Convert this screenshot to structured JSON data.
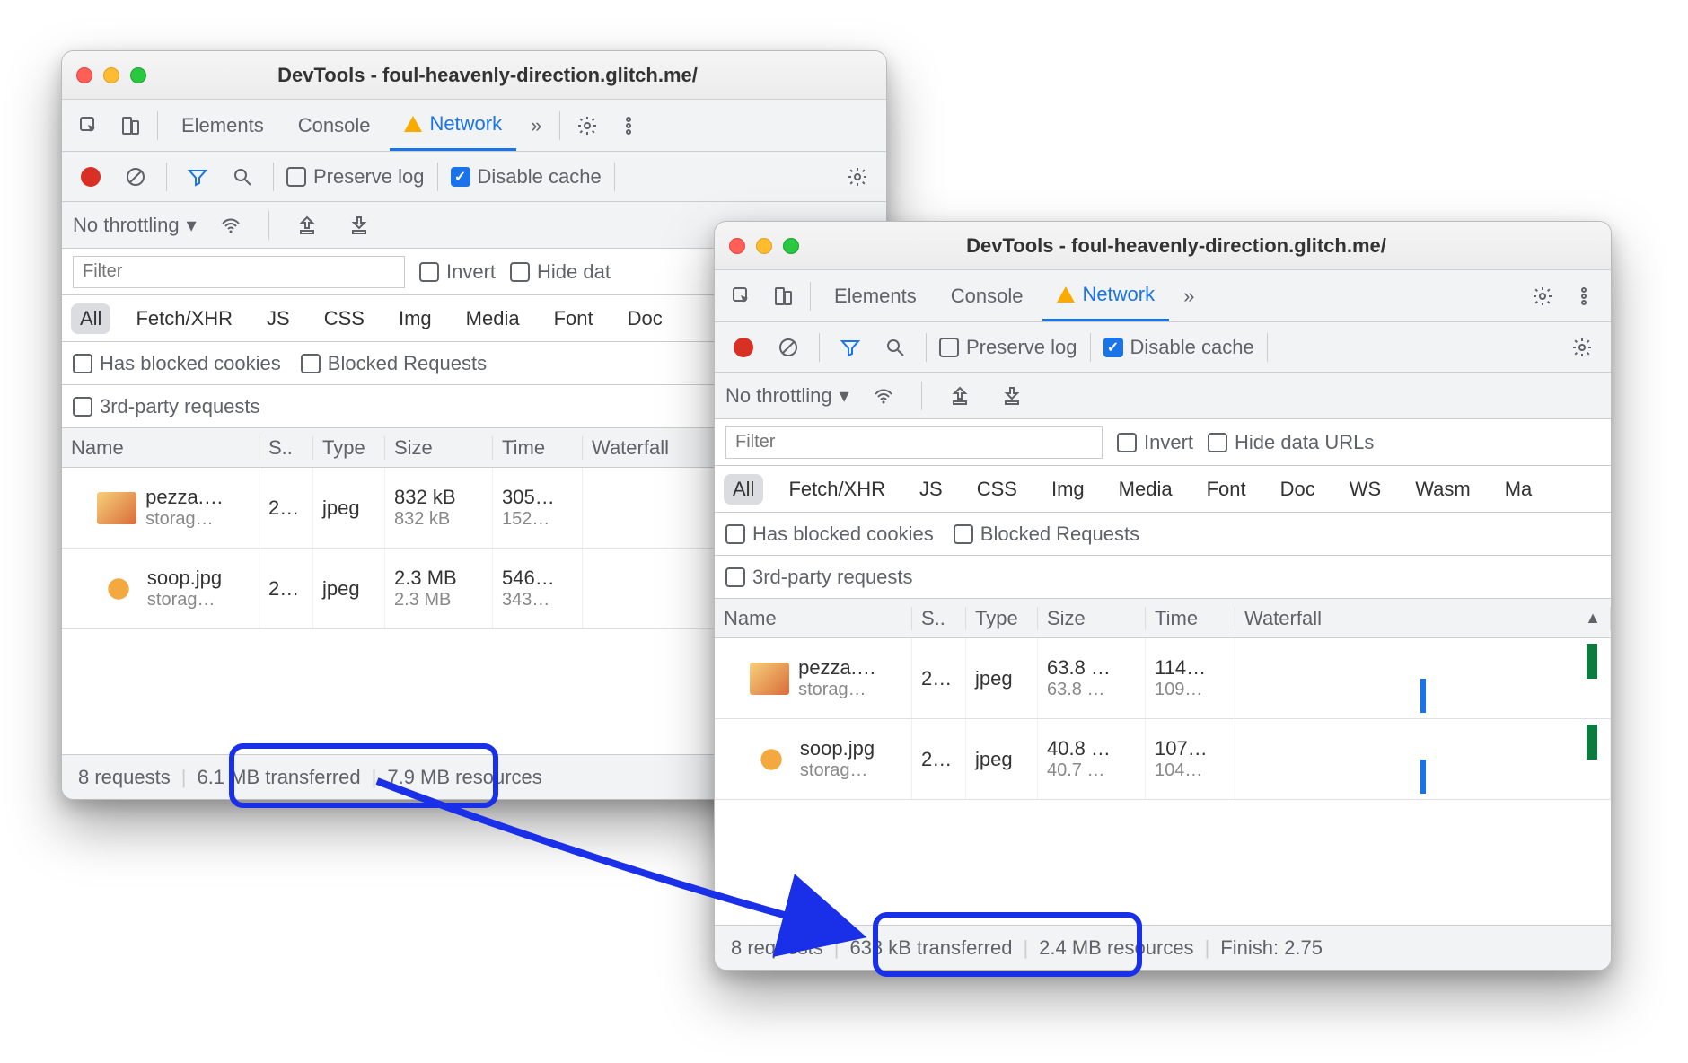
{
  "window_title": "DevTools - foul-heavenly-direction.glitch.me/",
  "tabs": {
    "elements": "Elements",
    "console": "Console",
    "network": "Network"
  },
  "toolbar": {
    "preserve_log": "Preserve log",
    "disable_cache": "Disable cache",
    "no_throttling": "No throttling"
  },
  "filterbar": {
    "filter_placeholder": "Filter",
    "invert": "Invert",
    "hide_short": "Hide dat",
    "hide_full": "Hide data URLs"
  },
  "types": {
    "all": "All",
    "fetch": "Fetch/XHR",
    "js": "JS",
    "css": "CSS",
    "img": "Img",
    "media": "Media",
    "font": "Font",
    "doc": "Doc",
    "ws": "WS",
    "wasm": "Wasm",
    "manifest": "Ma"
  },
  "extras": {
    "blocked_cookies": "Has blocked cookies",
    "blocked_requests": "Blocked Requests",
    "third_party": "3rd-party requests"
  },
  "headers": {
    "name": "Name",
    "status": "S..",
    "type": "Type",
    "size": "Size",
    "time": "Time",
    "waterfall": "Waterfall"
  },
  "win1": {
    "rows": [
      {
        "name": "pezza.…",
        "domain": "storag…",
        "status": "2…",
        "type": "jpeg",
        "size1": "832 kB",
        "size2": "832 kB",
        "time1": "305…",
        "time2": "152…"
      },
      {
        "name": "soop.jpg",
        "domain": "storag…",
        "status": "2…",
        "type": "jpeg",
        "size1": "2.3 MB",
        "size2": "2.3 MB",
        "time1": "546…",
        "time2": "343…"
      }
    ],
    "status": {
      "requests": "8 requests",
      "transferred": "6.1 MB transferred",
      "resources": "7.9 MB resources"
    }
  },
  "win2": {
    "rows": [
      {
        "name": "pezza.…",
        "domain": "storag…",
        "status": "2…",
        "type": "jpeg",
        "size1": "63.8 …",
        "size2": "63.8 …",
        "time1": "114…",
        "time2": "109…"
      },
      {
        "name": "soop.jpg",
        "domain": "storag…",
        "status": "2…",
        "type": "jpeg",
        "size1": "40.8 …",
        "size2": "40.7 …",
        "time1": "107…",
        "time2": "104…"
      }
    ],
    "status": {
      "requests": "8 requests",
      "transferred": "633 kB transferred",
      "resources": "2.4 MB resources",
      "finish": "Finish: 2.75"
    }
  }
}
